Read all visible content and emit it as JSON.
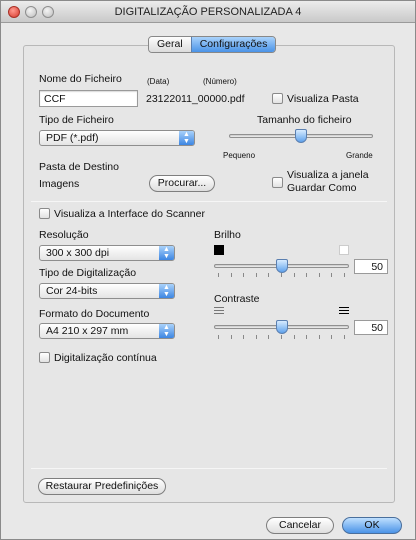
{
  "window": {
    "title": "DIGITALIZAÇÃO PERSONALIZADA 4"
  },
  "tabs": [
    {
      "label": "Geral"
    },
    {
      "label": "Configurações"
    }
  ],
  "file": {
    "name_label": "Nome do Ficheiro",
    "date_label": "(Data)",
    "number_label": "(Número)",
    "name_value": "CCF",
    "generated_name": "23122011_00000.pdf",
    "show_folder_label": "Visualiza Pasta",
    "show_folder_checked": false
  },
  "file_type": {
    "label": "Tipo de Ficheiro",
    "selected": "PDF (*.pdf)"
  },
  "file_size": {
    "label": "Tamanho do ficheiro",
    "min_label": "Pequeno",
    "max_label": "Grande",
    "level": 0.5
  },
  "destination": {
    "label": "Pasta de Destino",
    "folder": "Imagens",
    "browse_label": "Procurar...",
    "save_as_label_1": "Visualiza a janela",
    "save_as_label_2": "Guardar Como",
    "save_as_checked": false
  },
  "scanner_interface": {
    "label": "Visualiza a Interface do Scanner",
    "checked": false
  },
  "resolution": {
    "label": "Resolução",
    "selected": "300 x 300 dpi"
  },
  "scan_type": {
    "label": "Tipo de Digitalização",
    "selected": "Cor 24-bits"
  },
  "doc_format": {
    "label": "Formato do Documento",
    "selected": "A4 210 x 297 mm"
  },
  "brightness": {
    "label": "Brilho",
    "value": "50"
  },
  "contrast": {
    "label": "Contraste",
    "value": "50"
  },
  "continuous": {
    "label": "Digitalização contínua",
    "checked": false
  },
  "buttons": {
    "restore": "Restaurar Predefinições",
    "cancel": "Cancelar",
    "ok": "OK"
  },
  "colors": {
    "accent": "#4a93e7",
    "close": "#d6392c"
  }
}
